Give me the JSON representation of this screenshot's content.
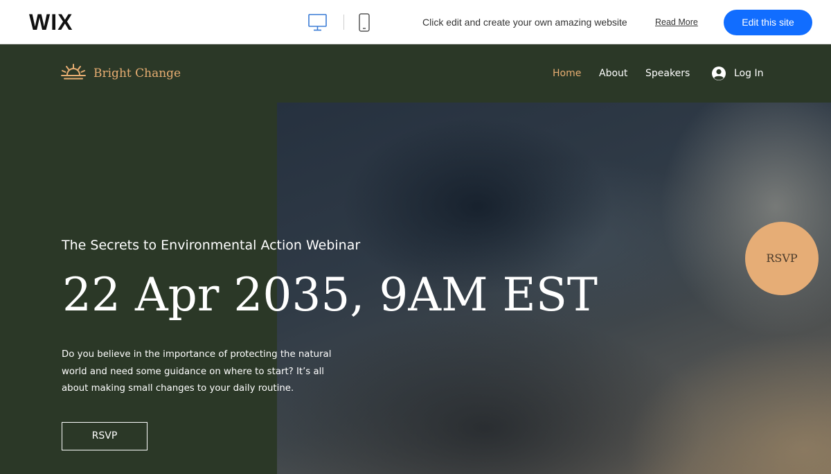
{
  "wix_bar": {
    "logo": "WIX",
    "desktop_icon": "desktop-monitor-icon",
    "mobile_icon": "mobile-phone-icon",
    "message": "Click edit and create your own amazing website",
    "read_more": "Read More",
    "edit_button": "Edit this site",
    "accent": "#116dff"
  },
  "site": {
    "brand": {
      "name": "Bright Change",
      "icon": "sunrise-icon",
      "color": "#e8ae72"
    },
    "nav": {
      "items": [
        "Home",
        "About",
        "Speakers"
      ],
      "active": "Home",
      "login_label": "Log In",
      "login_icon": "user-icon"
    },
    "hero": {
      "subtitle": "The Secrets to Environmental Action Webinar",
      "datetime": "22 Apr 2035, 9AM EST",
      "description": "Do you believe in the importance of protecting the natural world and need some guidance on where to start? It’s all about making small changes to your daily routine.",
      "rsvp_button": "RSVP",
      "rsvp_badge": "RSVP",
      "background": "#2b3827",
      "badge_color": "#e6ad76"
    }
  }
}
